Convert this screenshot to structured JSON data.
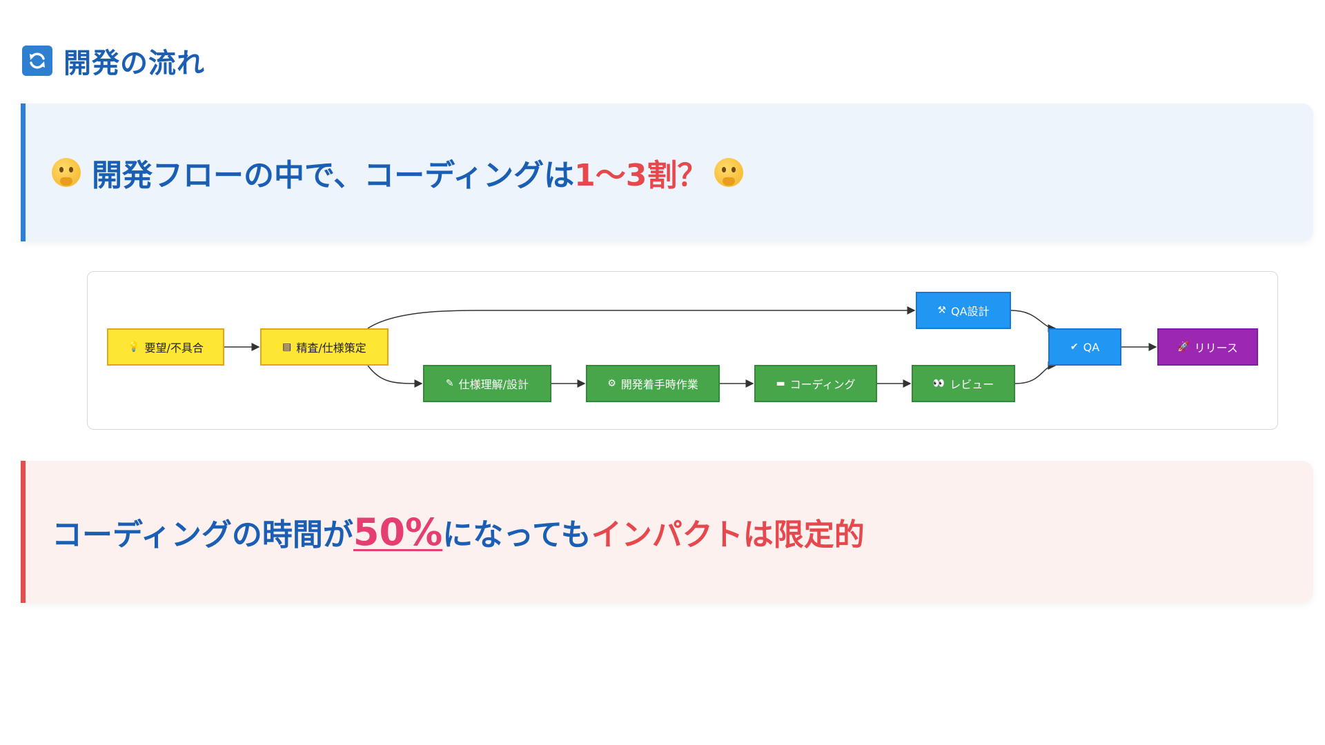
{
  "header": {
    "title": "開発の流れ",
    "icon": "refresh-icon"
  },
  "question_callout": {
    "prefix": "開発フローの中で、コーディングは",
    "highlight": "1〜3割？",
    "icon": "thinking-face-icon",
    "accent_color": "#2e7fd6"
  },
  "flow": {
    "nodes": [
      {
        "id": "request",
        "label": "要望/不具合",
        "icon": "💡",
        "color": "yellow"
      },
      {
        "id": "scrutiny",
        "label": "精査/仕様策定",
        "icon": "▤",
        "color": "yellow"
      },
      {
        "id": "spec-understanding",
        "label": "仕様理解/設計",
        "icon": "✎",
        "color": "green"
      },
      {
        "id": "dev-start",
        "label": "開発着手時作業",
        "icon": "⚙",
        "color": "green"
      },
      {
        "id": "coding",
        "label": "コーディング",
        "icon": "▬",
        "color": "green"
      },
      {
        "id": "review",
        "label": "レビュー",
        "icon": "👀",
        "color": "green"
      },
      {
        "id": "qa-design",
        "label": "QA設計",
        "icon": "⚒",
        "color": "blue"
      },
      {
        "id": "qa",
        "label": "QA",
        "icon": "✔",
        "color": "blue"
      },
      {
        "id": "release",
        "label": "リリース",
        "icon": "🚀",
        "color": "purple"
      }
    ],
    "edges": [
      [
        "request",
        "scrutiny"
      ],
      [
        "scrutiny",
        "qa-design"
      ],
      [
        "scrutiny",
        "spec-understanding"
      ],
      [
        "spec-understanding",
        "dev-start"
      ],
      [
        "dev-start",
        "coding"
      ],
      [
        "coding",
        "review"
      ],
      [
        "qa-design",
        "qa"
      ],
      [
        "review",
        "qa"
      ],
      [
        "qa",
        "release"
      ]
    ],
    "colors": {
      "yellow": "#fde634",
      "green": "#47a649",
      "blue": "#2196f3",
      "purple": "#9c27b0"
    }
  },
  "impact_callout": {
    "prefix": "コーディングの時間が",
    "percent": "50%",
    "middle": "になっても",
    "emphasis": "インパクトは限定的",
    "accent_color": "#e24f4f"
  }
}
